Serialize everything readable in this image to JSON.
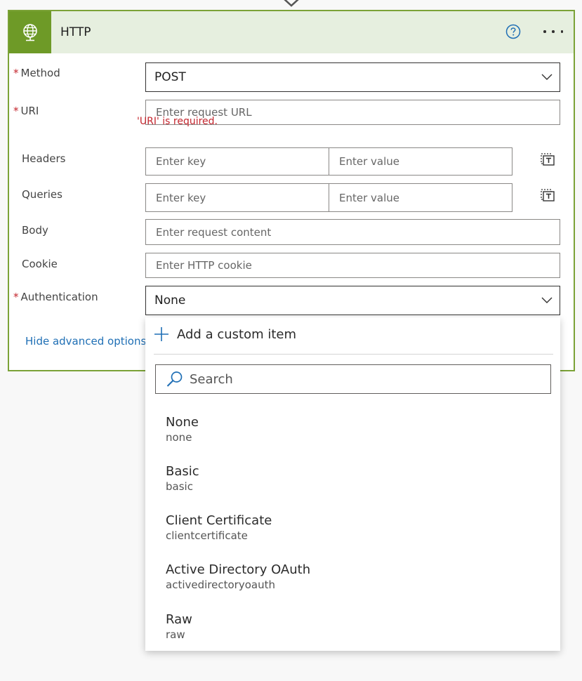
{
  "card": {
    "title": "HTTP",
    "icons": {
      "app": "globe-icon",
      "help": "help-circle-icon",
      "more": "more-ellipsis-icon",
      "delete": "delete-icon"
    },
    "colors": {
      "accent": "#6e9a27",
      "header": "#e6efdf",
      "error": "#c4262e",
      "link": "#1f6fb5"
    }
  },
  "fields": {
    "method": {
      "label": "Method",
      "required": "*",
      "value": "POST"
    },
    "uri": {
      "label": "URI",
      "required": "*",
      "placeholder": "Enter request URL",
      "error": "'URI' is required."
    },
    "headers": {
      "label": "Headers",
      "key_placeholder": "Enter key",
      "value_placeholder": "Enter value"
    },
    "queries": {
      "label": "Queries",
      "key_placeholder": "Enter key",
      "value_placeholder": "Enter value"
    },
    "body": {
      "label": "Body",
      "placeholder": "Enter request content"
    },
    "cookie": {
      "label": "Cookie",
      "placeholder": "Enter HTTP cookie"
    },
    "authentication": {
      "label": "Authentication",
      "required": "*",
      "value": "None"
    }
  },
  "advanced_link": "Hide advanced options",
  "dropdown": {
    "add_custom": "Add a custom item",
    "search_placeholder": "Search",
    "options": [
      {
        "name": "None",
        "value": "none"
      },
      {
        "name": "Basic",
        "value": "basic"
      },
      {
        "name": "Client Certificate",
        "value": "clientcertificate"
      },
      {
        "name": "Active Directory OAuth",
        "value": "activedirectoryoauth"
      },
      {
        "name": "Raw",
        "value": "raw"
      }
    ]
  }
}
